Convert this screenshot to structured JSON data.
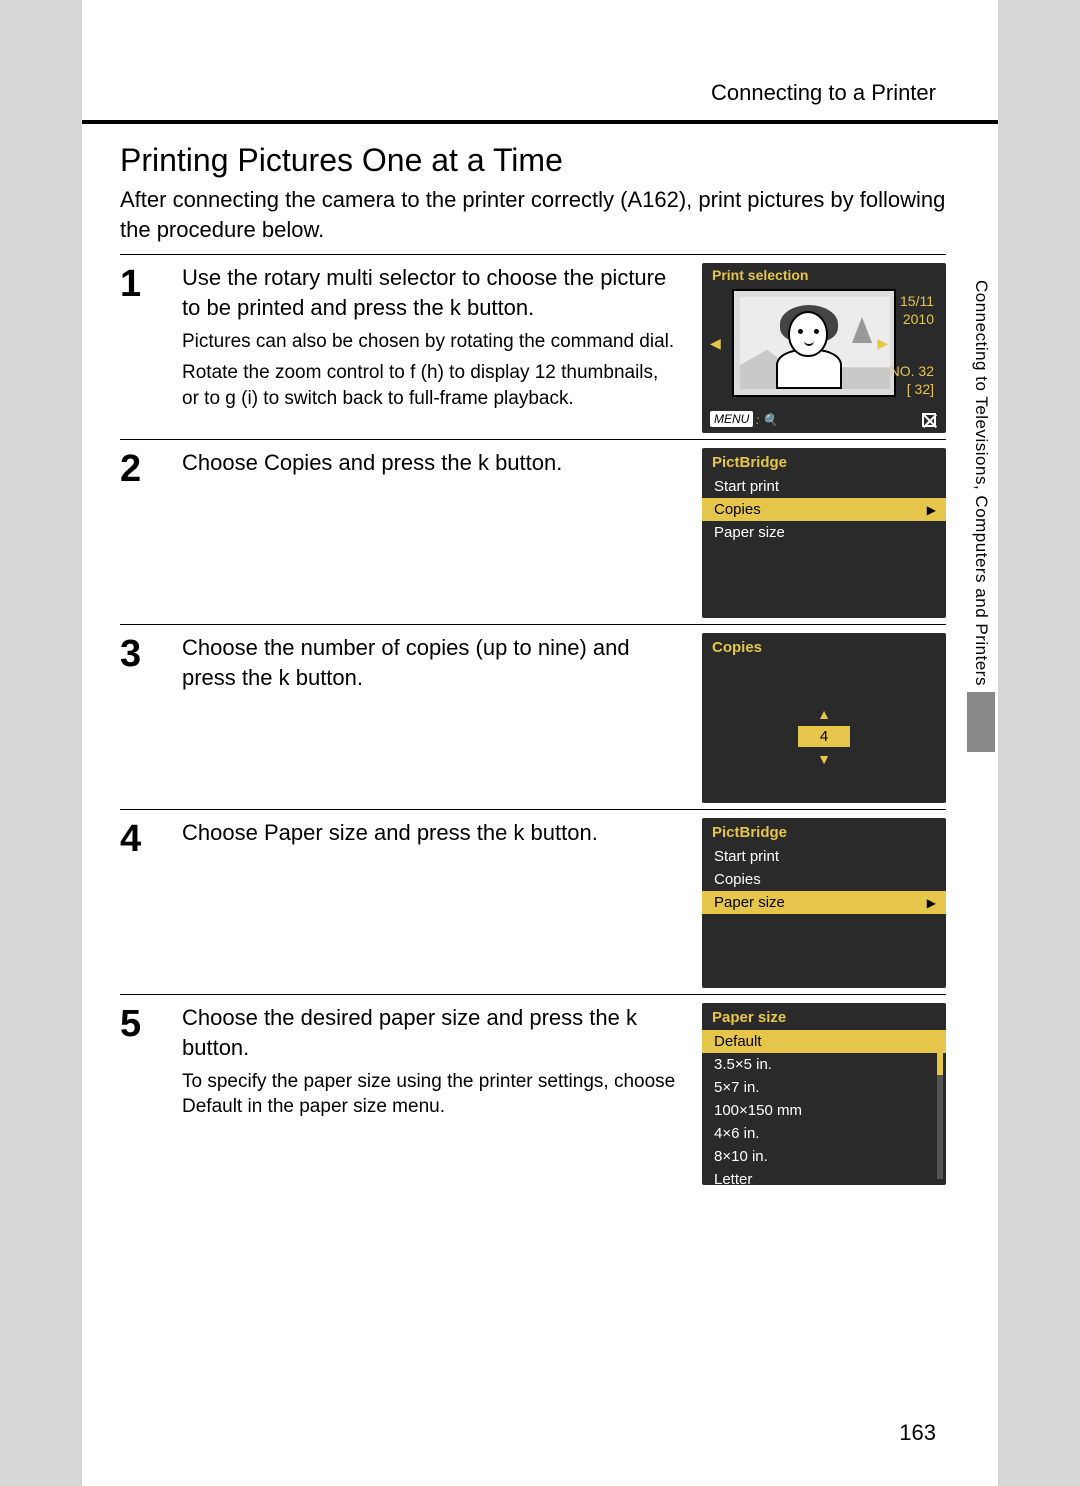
{
  "header": {
    "section": "Connecting to a Printer"
  },
  "title": "Printing Pictures One at a Time",
  "intro": "After connecting the camera to the printer correctly (A162), print pictures by following the procedure below.",
  "side": {
    "text": "Connecting to Televisions, Computers and Printers"
  },
  "page_number": "163",
  "steps": [
    {
      "num": "1",
      "main": "Use the rotary multi selector to choose the picture to be printed and press the k button.",
      "notes": [
        "Pictures can also be chosen by rotating the command dial.",
        "Rotate the zoom control to f (h) to display 12 thumbnails, or to g (i) to switch back to full-frame playback."
      ],
      "lcd": {
        "kind": "print",
        "title": "Print selection",
        "date1": "15/11",
        "date2": "2010",
        "no": "NO. 32",
        "xn": "[   32]",
        "menu": "MENU",
        "zoom": "␣"
      }
    },
    {
      "num": "2",
      "main": "Choose Copies and press the k button.",
      "lcd": {
        "kind": "menu",
        "title": "PictBridge",
        "items": [
          "Start print",
          "Copies",
          "Paper size"
        ],
        "selected": 1
      }
    },
    {
      "num": "3",
      "main": "Choose the number of copies (up to nine) and press the k button.",
      "lcd": {
        "kind": "copies",
        "title": "Copies",
        "value": "4"
      }
    },
    {
      "num": "4",
      "main": "Choose Paper size and press the k button.",
      "lcd": {
        "kind": "menu",
        "title": "PictBridge",
        "items": [
          "Start print",
          "Copies",
          "Paper size"
        ],
        "selected": 2
      }
    },
    {
      "num": "5",
      "main": "Choose the desired paper size and press the k button.",
      "notes": [
        "To specify the paper size using the printer settings, choose Default in the paper size menu."
      ],
      "lcd": {
        "kind": "paper",
        "title": "Paper size",
        "items": [
          "Default",
          "3.5×5 in.",
          "5×7 in.",
          "100×150 mm",
          "4×6 in.",
          "8×10 in.",
          "Letter"
        ],
        "selected": 0
      }
    }
  ]
}
